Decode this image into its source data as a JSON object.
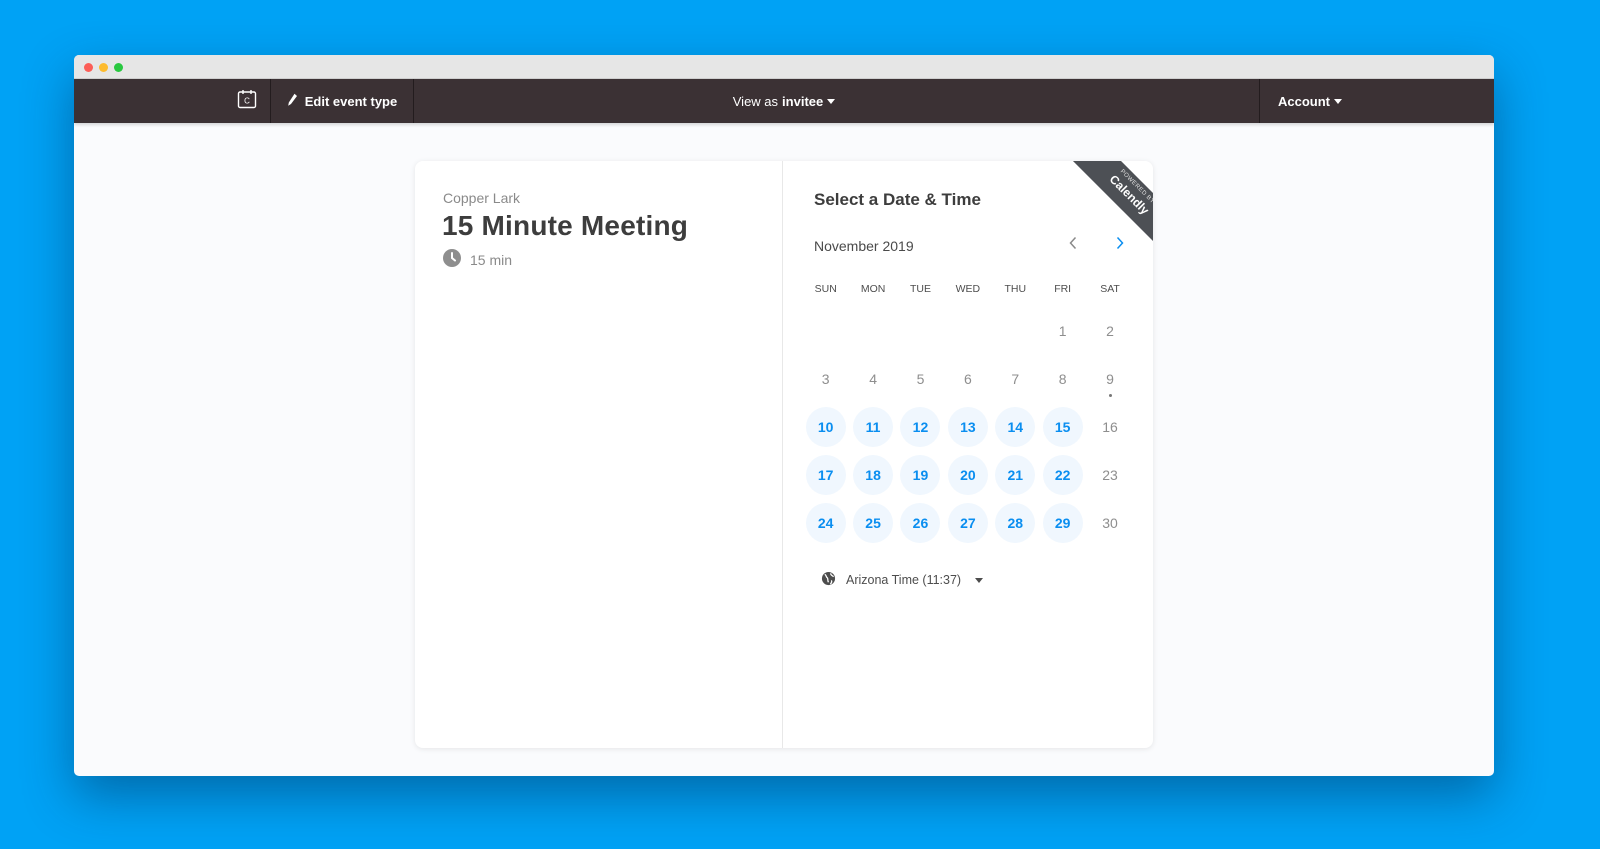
{
  "window": {
    "traffic_lights": [
      "close",
      "minimize",
      "maximize"
    ]
  },
  "navbar": {
    "logo_icon": "calendar-c-icon",
    "edit_label": "Edit event type",
    "edit_icon": "pencil-icon",
    "view_prefix": "View as",
    "view_value": "invitee",
    "account_label": "Account"
  },
  "event": {
    "host": "Copper Lark",
    "title": "15 Minute Meeting",
    "duration": "15 min",
    "duration_icon": "clock-icon"
  },
  "scheduler": {
    "title": "Select a Date & Time",
    "month": "November 2019",
    "prev_icon": "chevron-left-icon",
    "next_icon": "chevron-right-icon",
    "ribbon_small": "POWERED BY",
    "ribbon_brand": "Calendly",
    "weekdays": [
      "SUN",
      "MON",
      "TUE",
      "WED",
      "THU",
      "FRI",
      "SAT"
    ],
    "leading_blanks": 5,
    "days": [
      {
        "n": "1",
        "available": false
      },
      {
        "n": "2",
        "available": false
      },
      {
        "n": "3",
        "available": false
      },
      {
        "n": "4",
        "available": false
      },
      {
        "n": "5",
        "available": false
      },
      {
        "n": "6",
        "available": false
      },
      {
        "n": "7",
        "available": false
      },
      {
        "n": "8",
        "available": false
      },
      {
        "n": "9",
        "available": false,
        "today": true
      },
      {
        "n": "10",
        "available": true
      },
      {
        "n": "11",
        "available": true
      },
      {
        "n": "12",
        "available": true
      },
      {
        "n": "13",
        "available": true
      },
      {
        "n": "14",
        "available": true
      },
      {
        "n": "15",
        "available": true
      },
      {
        "n": "16",
        "available": false
      },
      {
        "n": "17",
        "available": true
      },
      {
        "n": "18",
        "available": true
      },
      {
        "n": "19",
        "available": true
      },
      {
        "n": "20",
        "available": true
      },
      {
        "n": "21",
        "available": true
      },
      {
        "n": "22",
        "available": true
      },
      {
        "n": "23",
        "available": false
      },
      {
        "n": "24",
        "available": true
      },
      {
        "n": "25",
        "available": true
      },
      {
        "n": "26",
        "available": true
      },
      {
        "n": "27",
        "available": true
      },
      {
        "n": "28",
        "available": true
      },
      {
        "n": "29",
        "available": true
      },
      {
        "n": "30",
        "available": false
      }
    ],
    "timezone": "Arizona Time (11:37)",
    "timezone_icon": "globe-icon"
  },
  "colors": {
    "background": "#00a2f5",
    "navbar": "#3b3134",
    "accent": "#0a8ef0",
    "available_bg": "#f0f7fe",
    "ribbon": "#4d5055"
  }
}
